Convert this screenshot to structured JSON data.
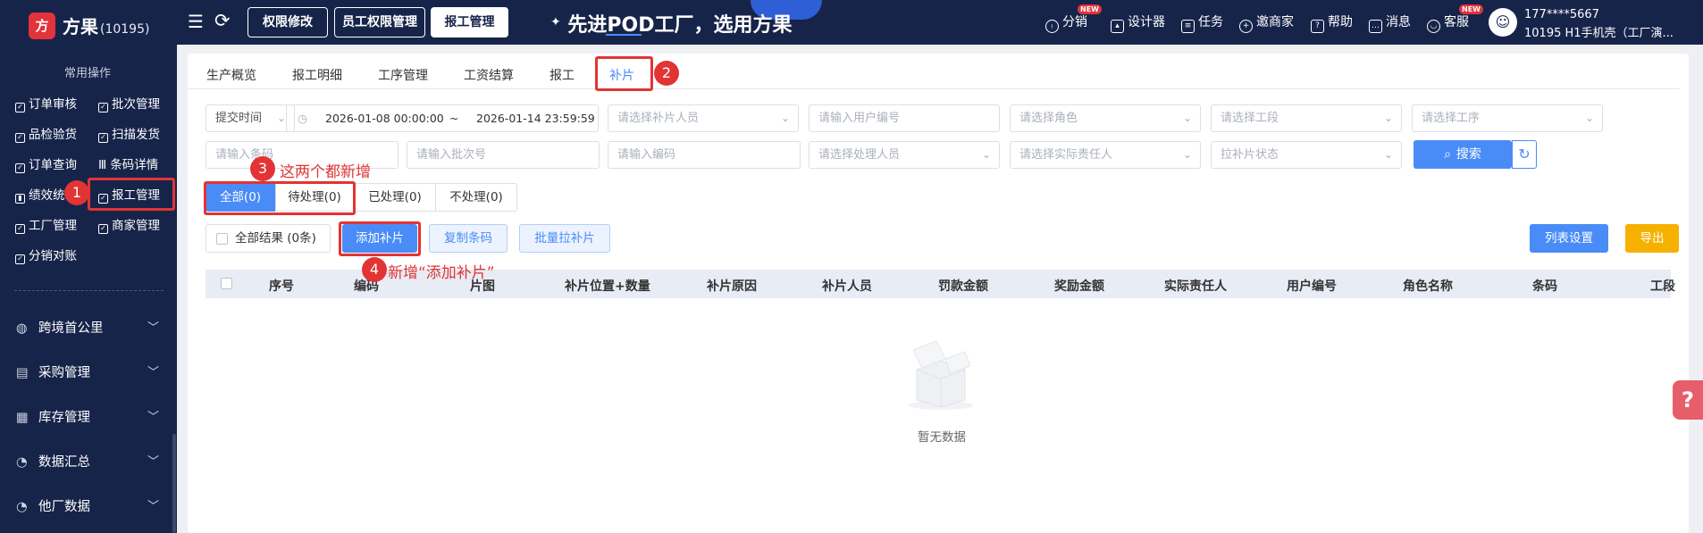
{
  "topbar": {
    "logo_glyph": "方",
    "brand": "方果",
    "brand_id": "(10195)",
    "buttons": [
      "权限修改",
      "员工权限管理",
      "报工管理"
    ],
    "slogan": "先进POD工厂，选用方果",
    "right_items": [
      "分销",
      "设计器",
      "任务",
      "邀商家",
      "帮助",
      "消息",
      "客服"
    ],
    "new_badge": "NEW",
    "user_phone": "177****5667",
    "user_info": "10195  H1手机壳（工厂演..."
  },
  "sidebar": {
    "section_title": "常用操作",
    "quick_items": [
      [
        "订单审核",
        "批次管理"
      ],
      [
        "品检验货",
        "扫描发货"
      ],
      [
        "订单查询",
        "条码详情"
      ],
      [
        "绩效统",
        "报工管理"
      ],
      [
        "工厂管理",
        "商家管理"
      ],
      [
        "分销对账"
      ]
    ],
    "groups": [
      "跨境首公里",
      "采购管理",
      "库存管理",
      "数据汇总",
      "他厂数据"
    ]
  },
  "tabs": [
    "生产概览",
    "报工明细",
    "工序管理",
    "工资结算",
    "报工",
    "补片"
  ],
  "active_tab": "补片",
  "filters": {
    "time_select": "提交时间",
    "date_start": "2026-01-08 00:00:00",
    "date_sep": "~",
    "date_end": "2026-01-14 23:59:59",
    "patch_person": "请选择补片人员",
    "user_code": "请输入用户编号",
    "role": "请选择角色",
    "work_section": "请选择工段",
    "process": "请选择工序",
    "row2_first": "请输入条码",
    "batch_no": "请输入批次号",
    "code": "请输入编码",
    "handler": "请选择处理人员",
    "responsible": "请选择实际责任人",
    "pull_status": "拉补片状态",
    "search_label": "搜索"
  },
  "status_tabs": [
    "全部(0)",
    "待处理(0)",
    "已处理(0)",
    "不处理(0)"
  ],
  "actions": {
    "all_results": "全部结果 (0条)",
    "add_patch": "添加补片",
    "copy_barcode": "复制条码",
    "batch_pull": "批量拉补片",
    "list_settings": "列表设置",
    "export": "导出"
  },
  "table": {
    "columns": [
      "序号",
      "编码",
      "片图",
      "补片位置+数量",
      "补片原因",
      "补片人员",
      "罚款金额",
      "奖励金额",
      "实际责任人",
      "用户编号",
      "角色名称",
      "条码",
      "工段"
    ],
    "empty_text": "暂无数据"
  },
  "annotations": {
    "badges": [
      "1",
      "2",
      "3",
      "4"
    ],
    "note3": "这两个都新增",
    "note4": "新增“添加补片”"
  },
  "colors": {
    "navy": "#17244a",
    "accent": "#4a8cf7",
    "annotation_red": "#e23434",
    "export_yellow": "#f6b100"
  }
}
